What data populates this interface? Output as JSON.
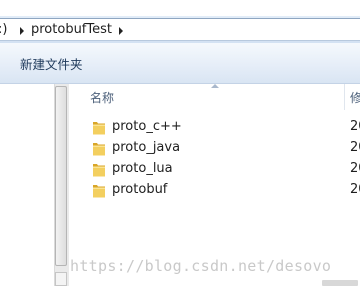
{
  "address_bar": {
    "partial_crumb": ":)",
    "folder": "protobufTest"
  },
  "toolbar": {
    "new_folder_label": "新建文件夹"
  },
  "file_list": {
    "columns": {
      "name": "名称",
      "date_partial": "修"
    },
    "items": [
      {
        "name": "proto_c++",
        "date_partial": "20",
        "icon": "folder-icon"
      },
      {
        "name": "proto_java",
        "date_partial": "20",
        "icon": "folder-icon"
      },
      {
        "name": "proto_lua",
        "date_partial": "20",
        "icon": "folder-icon"
      },
      {
        "name": "protobuf",
        "date_partial": "20",
        "icon": "folder-icon"
      }
    ]
  },
  "watermark": "https://blog.csdn.net/desovo",
  "colors": {
    "toolbar_text": "#1e395b",
    "header_text": "#4c607a",
    "folder_yellow": "#e8c14e"
  }
}
